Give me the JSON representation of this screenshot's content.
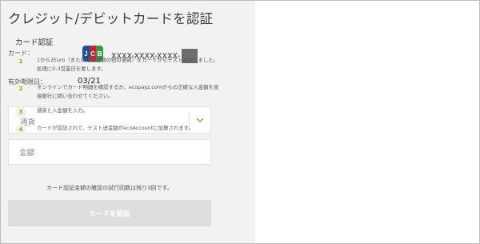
{
  "page": {
    "title": "クレジット/デビットカードを認証"
  },
  "card": {
    "label": "カード：",
    "brand_icon": "jcb-logo-icon",
    "brand_letters": [
      "J",
      "C",
      "B"
    ],
    "number": "XXXX-XXXX-XXXX-",
    "expiry_label": "有効期限日：",
    "expiry_value": "03/21"
  },
  "form": {
    "currency_placeholder": "通貨",
    "chevron_icon": "chevron-down-icon",
    "amount_placeholder": "金額",
    "attempts_note": "カード認証金額の確認の試行回数は残り3回です。",
    "submit_label": "カードを認証"
  },
  "steps": {
    "title": "カード認証",
    "items": [
      {
        "number": "1",
        "text": "1から2Euro（または相当金額の他の通貨）をカードからテスト送金しました。処理に0-3営業日を要します。"
      },
      {
        "number": "2",
        "text": "オンラインでカード明細を確認するか、ecopayz.comからの正確な入金額を直接銀行に問い合わせてください。"
      },
      {
        "number": "3",
        "text": "通貨と入金額を入力。"
      },
      {
        "number": "4",
        "text": "カードが認証されて、テスト送金額がecoAccountに加算されます。"
      }
    ]
  },
  "colors": {
    "accent": "#78a83a",
    "left_panel_bg": "#f3f2f2",
    "button_disabled": "#dedede"
  }
}
